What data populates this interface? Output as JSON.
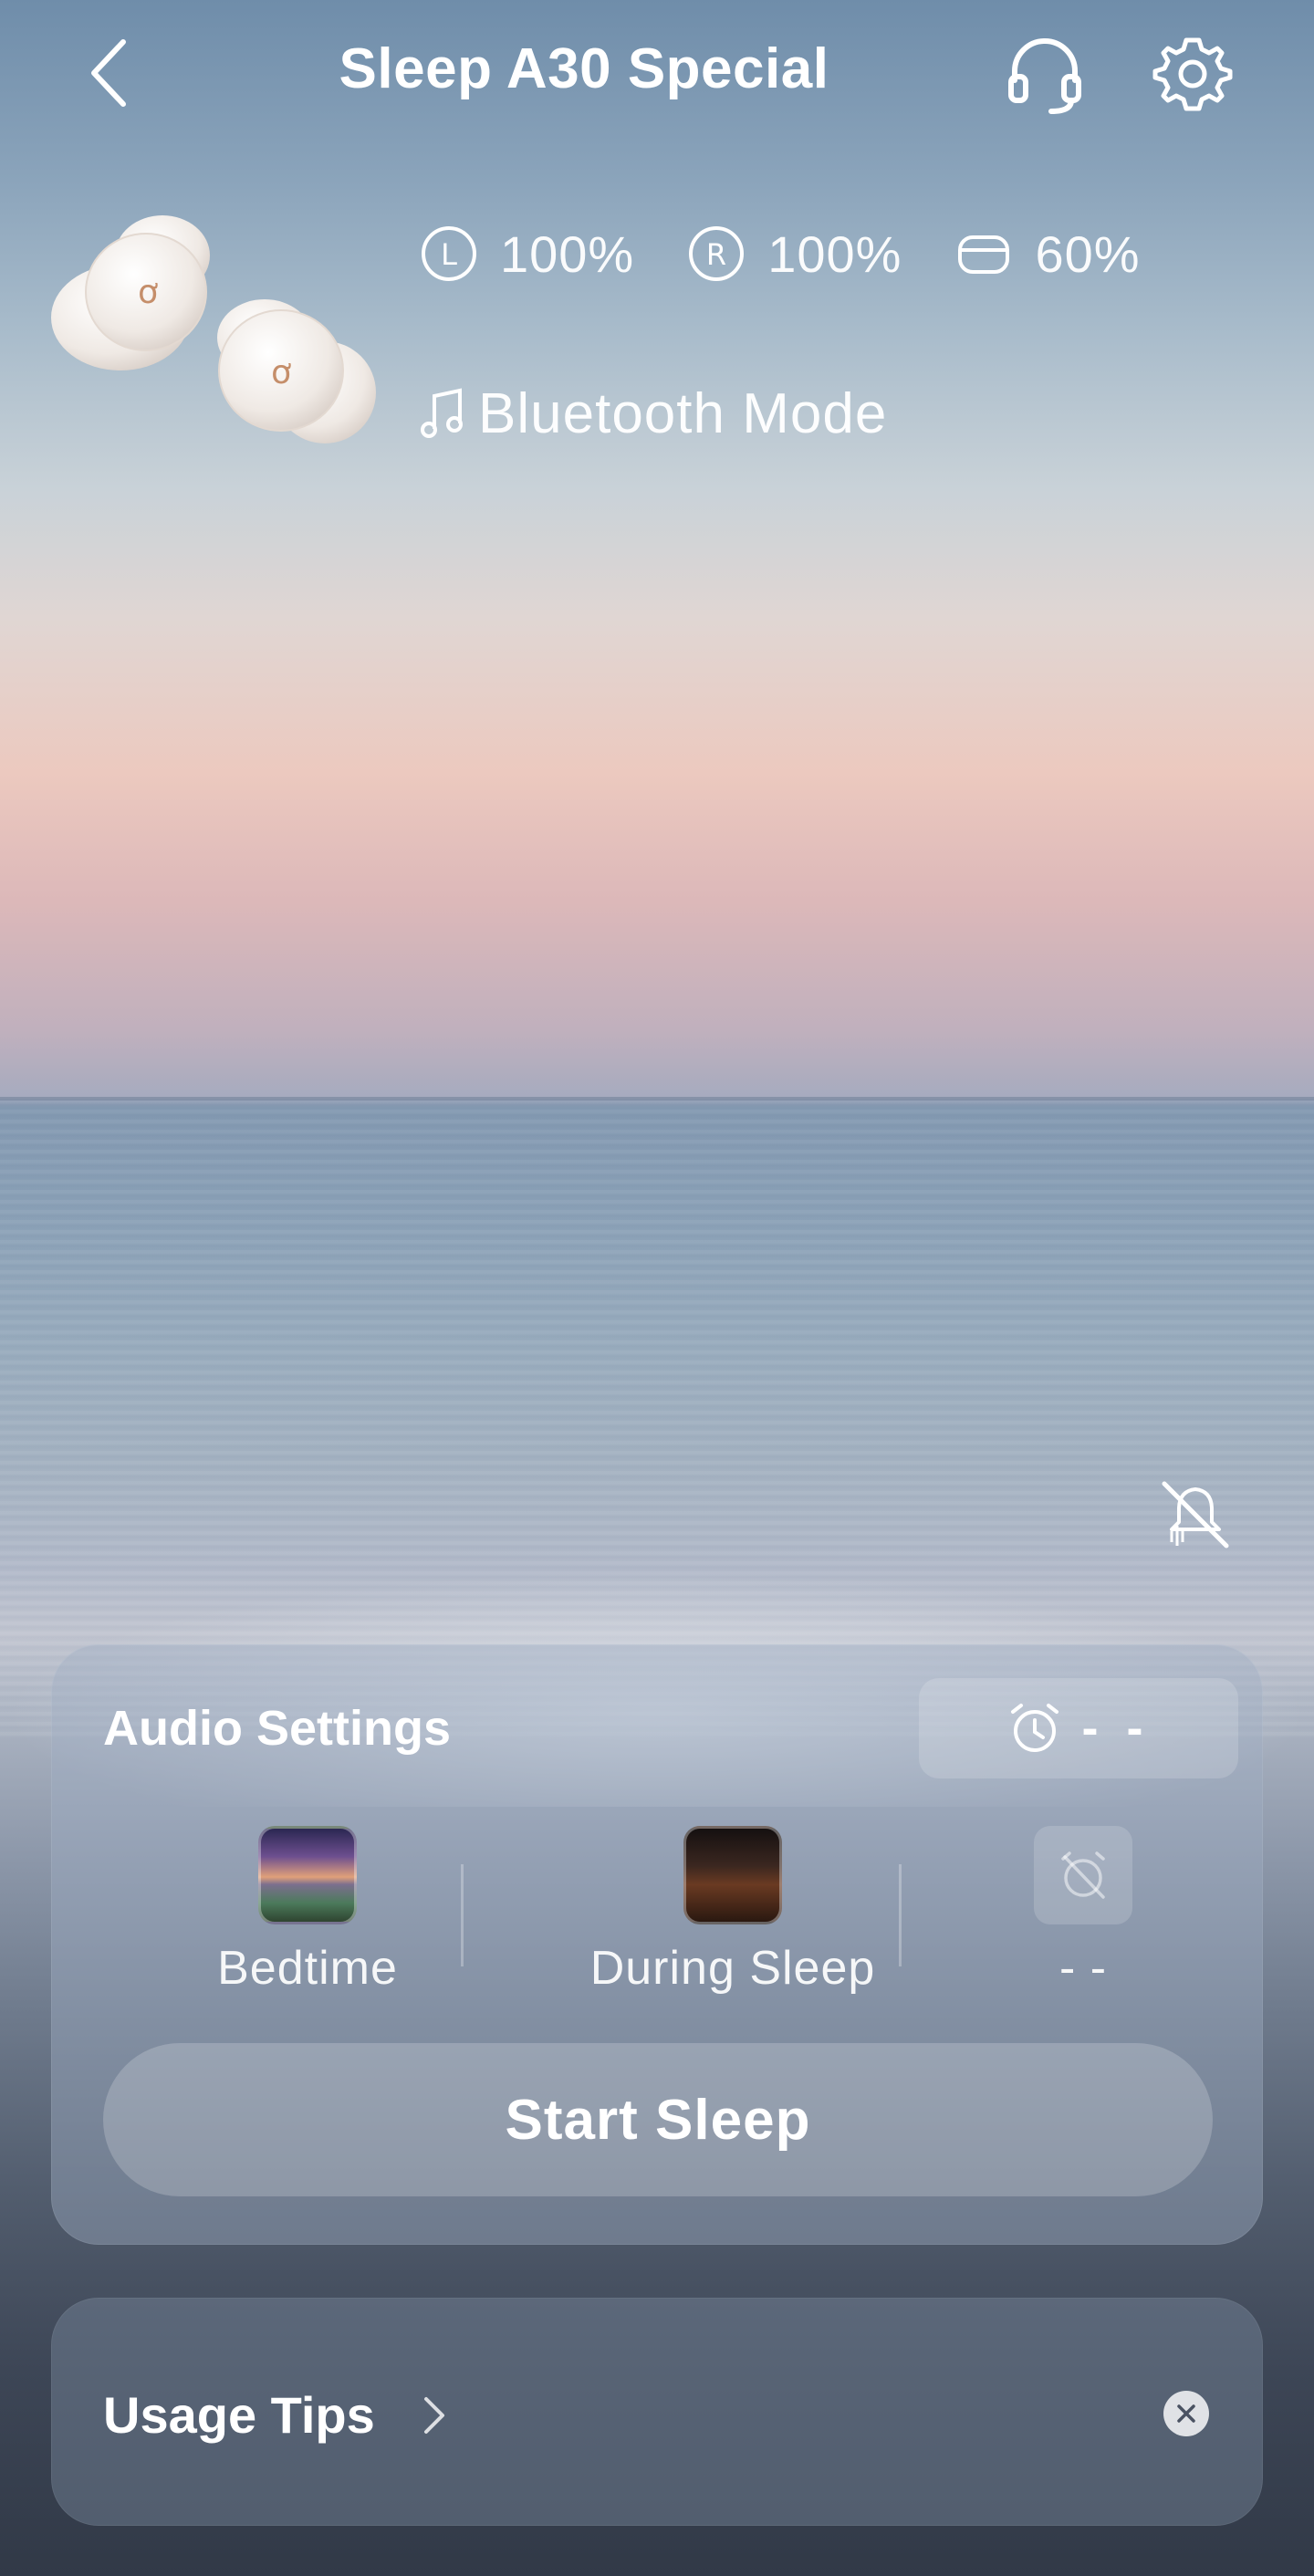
{
  "header": {
    "title": "Sleep A30 Special"
  },
  "status": {
    "left_battery": "100%",
    "right_battery": "100%",
    "case_battery": "60%",
    "mode": "Bluetooth Mode"
  },
  "audio_settings": {
    "title": "Audio Settings",
    "alarm_value": "- -",
    "modes": [
      {
        "label": "Bedtime"
      },
      {
        "label": "During Sleep"
      },
      {
        "label": "- -"
      }
    ],
    "start_button": "Start Sleep"
  },
  "tips": {
    "title": "Usage Tips"
  },
  "icons": {
    "back": "chevron-left-icon",
    "headset": "headset-icon",
    "settings": "gear-icon",
    "left_bud": "letter-l-circle-icon",
    "right_bud": "letter-r-circle-icon",
    "case": "case-icon",
    "music": "music-note-icon",
    "mute": "speaker-off-icon",
    "alarm": "alarm-clock-icon",
    "no_alarm": "alarm-off-icon",
    "chevron": "chevron-right-icon",
    "close": "close-icon"
  }
}
